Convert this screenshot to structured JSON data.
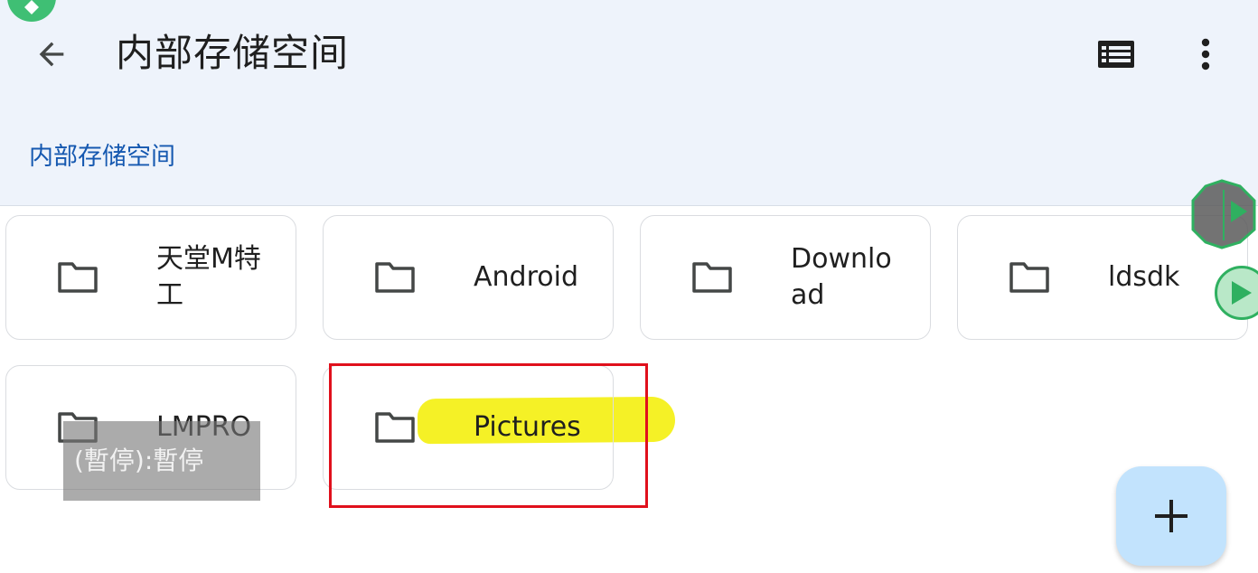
{
  "header": {
    "title": "内部存储空间",
    "breadcrumb": "内部存储空间",
    "back_icon": "arrow-back-icon",
    "list_view_icon": "list-view-icon",
    "more_icon": "more-vert-icon"
  },
  "folders": [
    {
      "name": "天堂M特工"
    },
    {
      "name": "Android"
    },
    {
      "name": "Download"
    },
    {
      "name": "ldsdk"
    },
    {
      "name": "LMPRO"
    },
    {
      "name": "Pictures"
    }
  ],
  "overlay": {
    "pause_text": "(暫停):暫停"
  },
  "fab": {
    "icon": "add-icon"
  },
  "colors": {
    "header_bg": "#eef3fb",
    "breadcrumb": "#1558b0",
    "highlight": "#f3ef00",
    "selection_box": "#e0101c",
    "fab_bg": "#c2e3fd"
  }
}
